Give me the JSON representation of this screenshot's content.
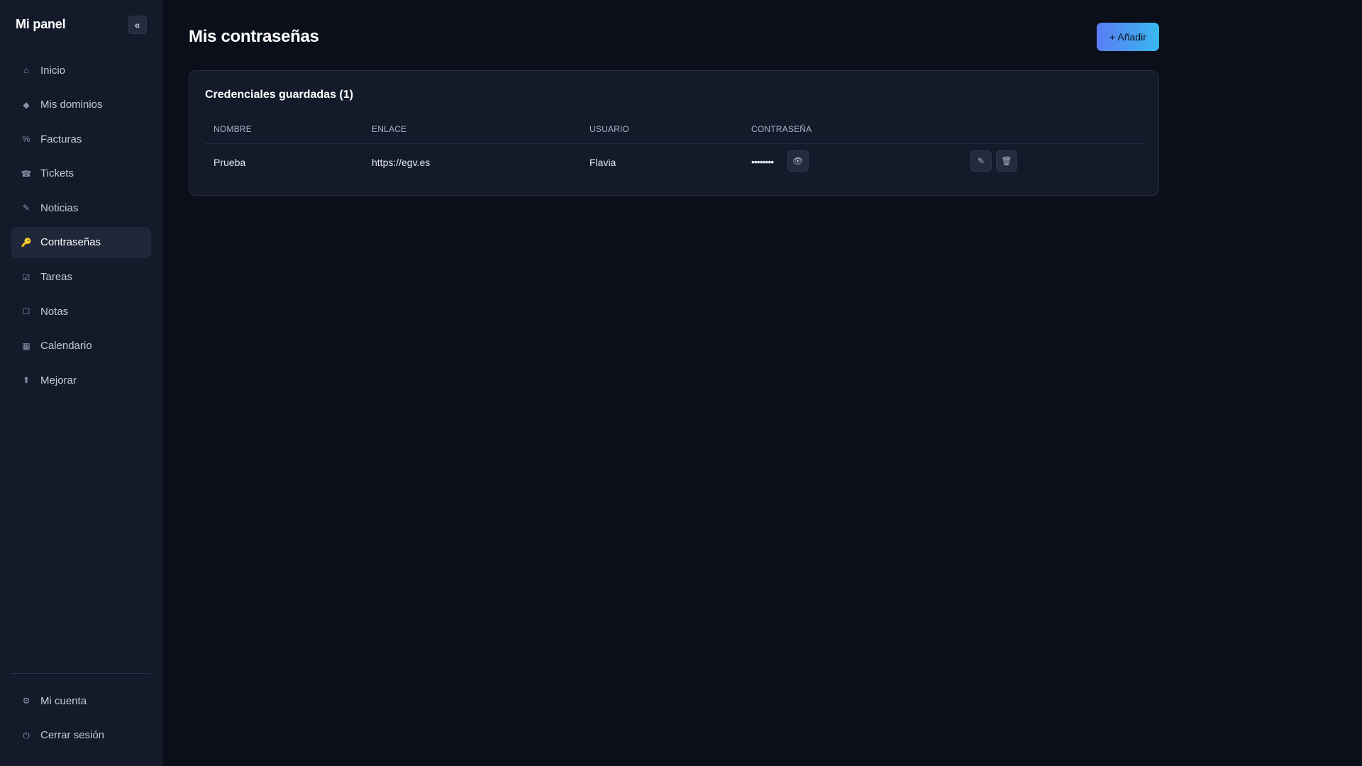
{
  "sidebar": {
    "brand": "Mi panel",
    "collapse_label": "«",
    "items": [
      {
        "label": "Inicio",
        "icon": "⌂",
        "active": false
      },
      {
        "label": "Mis dominios",
        "icon": "◆",
        "active": false
      },
      {
        "label": "Facturas",
        "icon": "%",
        "active": false
      },
      {
        "label": "Tickets",
        "icon": "☎",
        "active": false
      },
      {
        "label": "Noticias",
        "icon": "✎",
        "active": false
      },
      {
        "label": "Contraseñas",
        "icon": "🔑",
        "active": true
      },
      {
        "label": "Tareas",
        "icon": "☑",
        "active": false
      },
      {
        "label": "Notas",
        "icon": "☐",
        "active": false
      },
      {
        "label": "Calendario",
        "icon": "▦",
        "active": false
      },
      {
        "label": "Mejorar",
        "icon": "⬆",
        "active": false
      }
    ],
    "bottom_items": [
      {
        "label": "Mi cuenta",
        "icon": "⚙"
      },
      {
        "label": "Cerrar sesión",
        "icon": "⏻"
      }
    ]
  },
  "main": {
    "title": "Mis contraseñas",
    "add_button": "+ Añadir",
    "card": {
      "title": "Credenciales guardadas (1)",
      "columns": [
        "NOMBRE",
        "ENLACE",
        "USUARIO",
        "CONTRASEÑA"
      ],
      "rows": [
        {
          "name": "Prueba",
          "link": "https://egv.es",
          "user": "Flavia",
          "password": "••••••••"
        }
      ],
      "row_icons": {
        "show": "👁",
        "edit": "✎",
        "delete": "🗑"
      }
    }
  },
  "colors": {
    "background": "#0b0f19",
    "sidebar": "#131a2a",
    "accent_start": "#5b7cf5",
    "accent_end": "#38b8ee",
    "active_icon": "#f5b42a"
  }
}
